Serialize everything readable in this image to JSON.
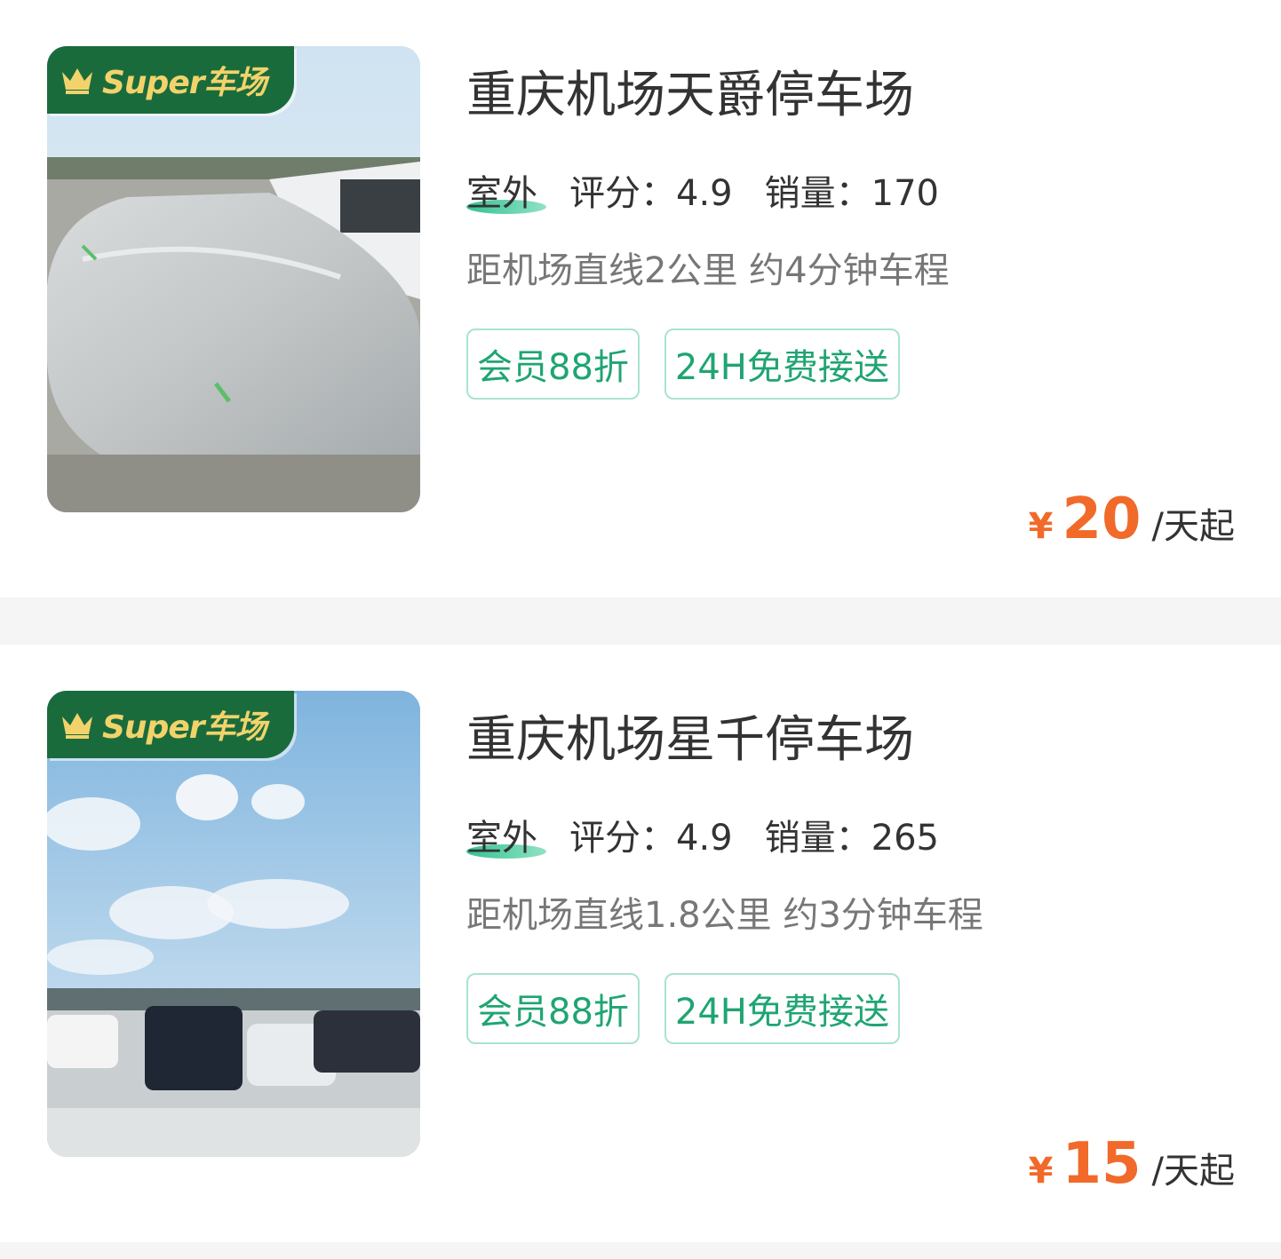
{
  "listings": [
    {
      "badge": "Super车场",
      "title": "重庆机场天爵停车场",
      "type": "室外",
      "rating_label": "评分：",
      "rating": "4.9",
      "sales_label": "销量：",
      "sales": "170",
      "distance": "距机场直线2公里 约4分钟车程",
      "tags": [
        "会员88折",
        "24H免费接送"
      ],
      "currency": "¥",
      "price": "20",
      "price_unit": "/天起"
    },
    {
      "badge": "Super车场",
      "title": "重庆机场星千停车场",
      "type": "室外",
      "rating_label": "评分：",
      "rating": "4.9",
      "sales_label": "销量：",
      "sales": "265",
      "distance": "距机场直线1.8公里 约3分钟车程",
      "tags": [
        "会员88折",
        "24H免费接送"
      ],
      "currency": "¥",
      "price": "15",
      "price_unit": "/天起"
    }
  ],
  "colors": {
    "accent_green": "#1fa572",
    "badge_green": "#1a6b3c",
    "price_orange": "#f16a2a"
  }
}
